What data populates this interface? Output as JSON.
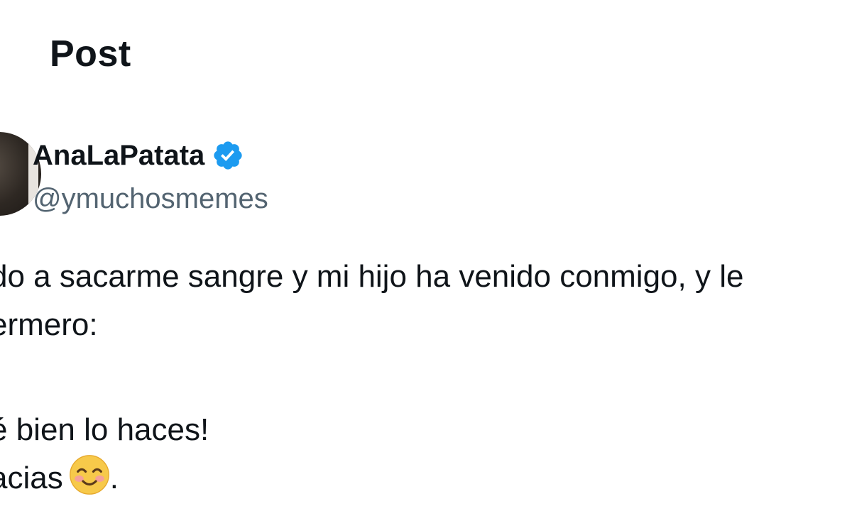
{
  "header": {
    "title": "Post"
  },
  "author": {
    "display_name": "AnaLaPatata",
    "handle": "@ymuchosmemes",
    "verified": true
  },
  "post": {
    "lines": [
      "do a sacarme sangre y mi hijo ha venido conmigo, y le",
      "ermero:",
      "",
      "é bien lo haces!",
      "acias",
      "."
    ]
  },
  "colors": {
    "verified_badge": "#1d9bf0",
    "handle_text": "#536471",
    "primary_text": "#0f1419"
  },
  "icons": {
    "verified": "verified-badge-icon",
    "emoji": "smiling-face-with-smiling-eyes-emoji"
  }
}
